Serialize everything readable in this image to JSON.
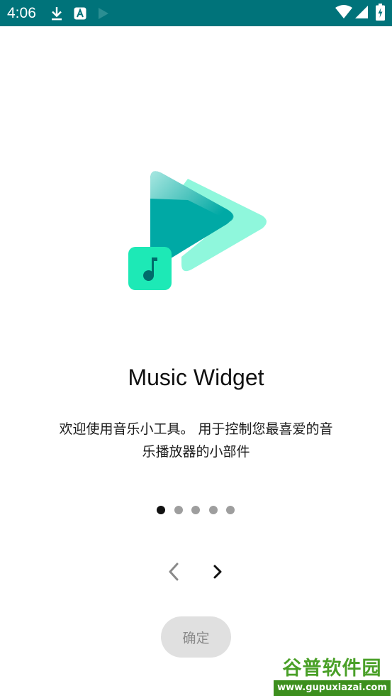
{
  "status_bar": {
    "time": "4:06",
    "icons": [
      "download-icon",
      "a-notification-icon",
      "play-store-icon",
      "wifi-icon",
      "cell-signal-icon",
      "battery-charging-icon"
    ],
    "background": "#00737a"
  },
  "hero": {
    "icon": "music-widget-logo-icon",
    "colors": {
      "front_triangle": "#00a9a5",
      "back_chevron": "#8ff7dc",
      "note_tile": "#1de9b6"
    }
  },
  "title": "Music Widget",
  "description": "欢迎使用音乐小工具。 用于控制您最喜爱的音乐播放器的小部件",
  "pager": {
    "total": 5,
    "active": 1
  },
  "nav": {
    "prev_icon": "chevron-left-icon",
    "next_icon": "chevron-right-icon"
  },
  "confirm_label": "确定",
  "watermark": {
    "main": "谷普软件园",
    "url": "www.gupuxiazai.com"
  }
}
